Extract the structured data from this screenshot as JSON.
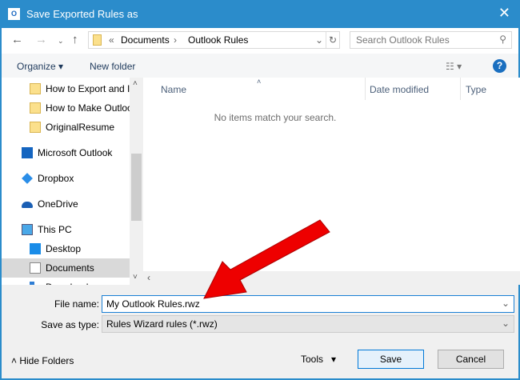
{
  "title": "Save Exported Rules as",
  "address": {
    "prefix": "«",
    "crumbs": [
      "Documents",
      "Outlook Rules"
    ]
  },
  "search_placeholder": "Search Outlook Rules",
  "toolbar": {
    "organize": "Organize",
    "new_folder": "New folder"
  },
  "nav_items": [
    {
      "label": "How to Export and Im",
      "icon": "folder-icon"
    },
    {
      "label": "How to Make Outlook",
      "icon": "folder-icon"
    },
    {
      "label": "OriginalResume",
      "icon": "folder-icon"
    },
    {
      "label": "Microsoft Outlook",
      "icon": "outlook-icon"
    },
    {
      "label": "Dropbox",
      "icon": "dropbox-icon"
    },
    {
      "label": "OneDrive",
      "icon": "onedrive-icon"
    },
    {
      "label": "This PC",
      "icon": "computer-icon"
    },
    {
      "label": "Desktop",
      "icon": "desktop-icon"
    },
    {
      "label": "Documents",
      "icon": "documents-icon",
      "selected": true
    },
    {
      "label": "Downloads",
      "icon": "downloads-icon"
    }
  ],
  "columns": [
    "Name",
    "Date modified",
    "Type"
  ],
  "empty_message": "No items match your search.",
  "file_name_label": "File name:",
  "file_name": "My Outlook Rules.rwz",
  "save_type_label": "Save as type:",
  "save_type": "Rules Wizard rules (*.rwz)",
  "hide_folders": "Hide Folders",
  "tools": "Tools",
  "save": "Save",
  "cancel": "Cancel"
}
